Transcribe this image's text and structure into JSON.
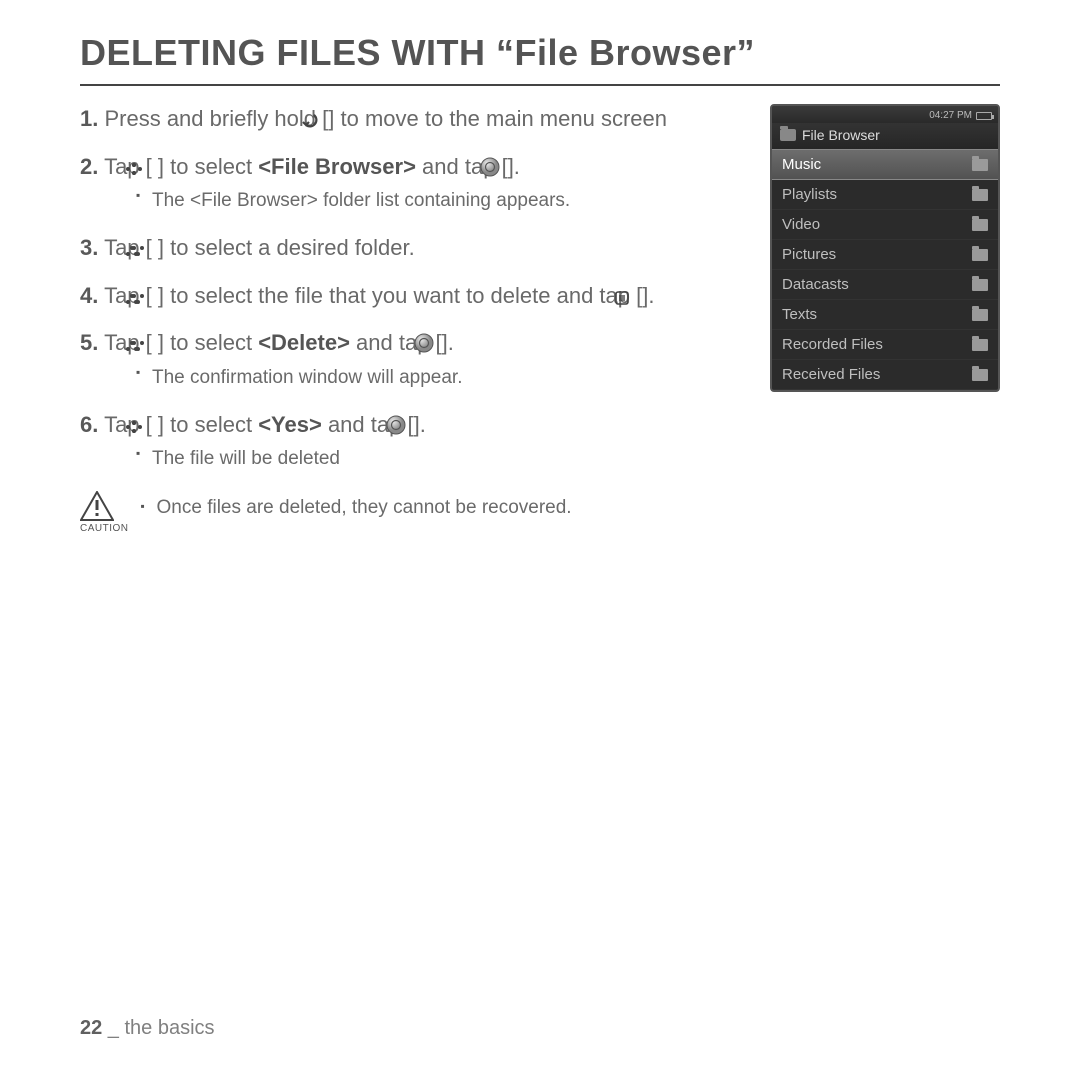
{
  "title": "DELETING FILES WITH “File Browser”",
  "steps": [
    {
      "num": "1.",
      "parts": [
        "Press and briefly hold [",
        "icon_back",
        "] to move to the main menu screen"
      ]
    },
    {
      "num": "2.",
      "parts": [
        "Tap [",
        "icon_left",
        " ",
        "icon_right",
        "] to select ",
        {
          "b": "<File Browser>"
        },
        " and tap [",
        "icon_ok",
        "]."
      ],
      "sub": [
        "The <File Browser> folder list containing appears."
      ]
    },
    {
      "num": "3.",
      "parts": [
        "Tap [",
        "icon_up",
        " ",
        "icon_down",
        "] to select a desired folder."
      ]
    },
    {
      "num": "4.",
      "parts": [
        "Tap [",
        "icon_up",
        " ",
        "icon_down",
        "] to select the file that you want to delete and tap [",
        "icon_menu",
        "]."
      ]
    },
    {
      "num": "5.",
      "parts": [
        "Tap [",
        "icon_up",
        " ",
        "icon_down",
        "] to select ",
        {
          "b": "<Delete>"
        },
        " and tap [",
        "icon_ok",
        "]."
      ],
      "sub": [
        "The confirmation window will appear."
      ]
    },
    {
      "num": "6.",
      "parts": [
        " Tap [",
        "icon_left",
        " ",
        "icon_right",
        "] to select ",
        {
          "b": "<Yes>"
        },
        " and tap [",
        "icon_ok",
        "]."
      ],
      "sub": [
        "The file will be deleted"
      ]
    }
  ],
  "caution": {
    "label": "CAUTION",
    "text": "Once files are deleted, they cannot be recovered."
  },
  "device": {
    "time": "04:27 PM",
    "header": "File Browser",
    "items": [
      {
        "label": "Music",
        "selected": true
      },
      {
        "label": "Playlists",
        "selected": false
      },
      {
        "label": "Video",
        "selected": false
      },
      {
        "label": "Pictures",
        "selected": false
      },
      {
        "label": "Datacasts",
        "selected": false
      },
      {
        "label": "Texts",
        "selected": false
      },
      {
        "label": "Recorded Files",
        "selected": false
      },
      {
        "label": "Received Files",
        "selected": false
      }
    ]
  },
  "footer": {
    "page": "22",
    "sep": " _ ",
    "section": "the basics"
  }
}
